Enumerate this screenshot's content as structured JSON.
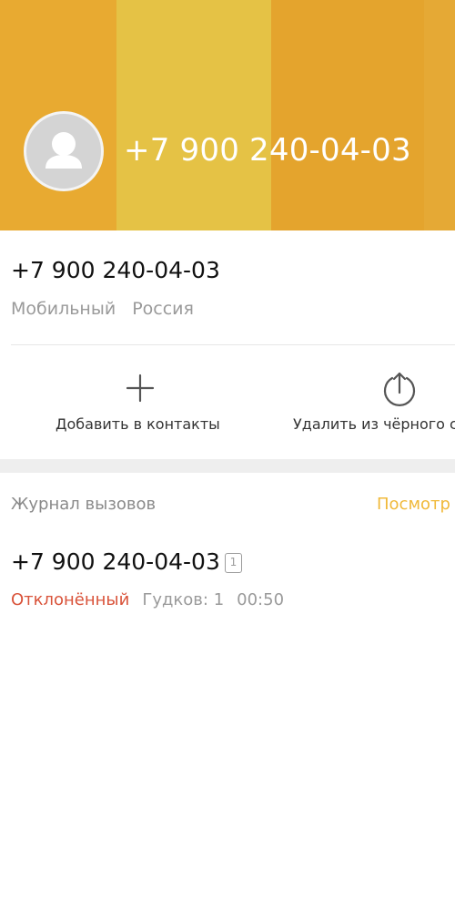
{
  "colors": {
    "header_stripe_1": "#e8aa31",
    "header_stripe_2": "#e5c245",
    "header_stripe_3": "#e4a42d",
    "header_stripe_4": "#e5a935",
    "accent": "#f0b93a",
    "declined": "#d9533a"
  },
  "header": {
    "avatar_icon": "person-placeholder-icon",
    "number": "+7 900 240-04-03"
  },
  "number_info": {
    "number": "+7 900 240-04-03",
    "type": "Мобильный",
    "region": "Россия"
  },
  "actions": {
    "add": {
      "icon": "plus-icon",
      "label": "Добавить в контакты"
    },
    "remove_blacklist": {
      "icon": "upload-arrow-icon",
      "label": "Удалить из чёрного с"
    }
  },
  "call_log": {
    "title": "Журнал вызовов",
    "view_link": "Посмотр",
    "entries": [
      {
        "number": "+7 900 240-04-03",
        "sim": "1",
        "status": "Отклонённый",
        "rings": "Гудков: 1",
        "time": "00:50"
      }
    ]
  }
}
